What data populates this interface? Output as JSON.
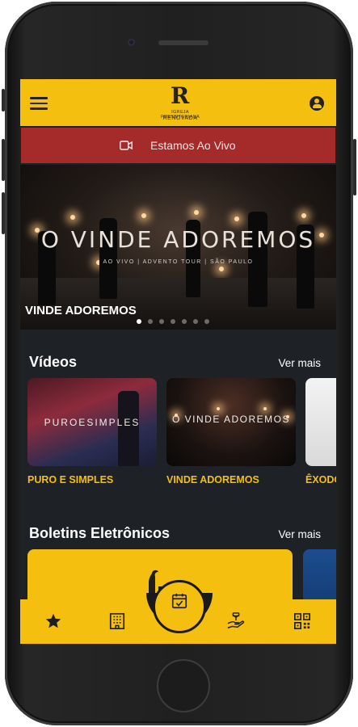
{
  "header": {
    "logo_letter": "R",
    "logo_small": "IGREJA PRESBITERIANA",
    "logo_name": "RENOVADA"
  },
  "live": {
    "label": "Estamos Ao Vivo",
    "color": "#a52a2a"
  },
  "banner": {
    "title": "O VINDE ADOREMOS",
    "subtitle": "AO VIVO | ADVENTO TOUR | SÃO PAULO",
    "caption": "VINDE ADOREMOS",
    "dots": 7,
    "active_dot": 0
  },
  "videos": {
    "title": "Vídeos",
    "see_more": "Ver mais",
    "items": [
      {
        "label": "PURO E SIMPLES",
        "thumb_text": "PUROESIMPLES"
      },
      {
        "label": "VINDE ADOREMOS",
        "thumb_text": "O VINDE ADOREMOS"
      },
      {
        "label": "ÊXODO",
        "thumb_text": ""
      }
    ]
  },
  "bulletins": {
    "title": "Boletins Eletrônicos",
    "see_more": "Ver mais"
  },
  "bottom_nav": {
    "items": [
      "star-icon",
      "building-icon",
      "calendar-check-icon",
      "donate-hand-icon",
      "qr-code-icon"
    ],
    "active": "calendar-check-icon"
  },
  "colors": {
    "accent": "#f5bf10",
    "background": "#1e2126",
    "text": "#ffffff"
  }
}
